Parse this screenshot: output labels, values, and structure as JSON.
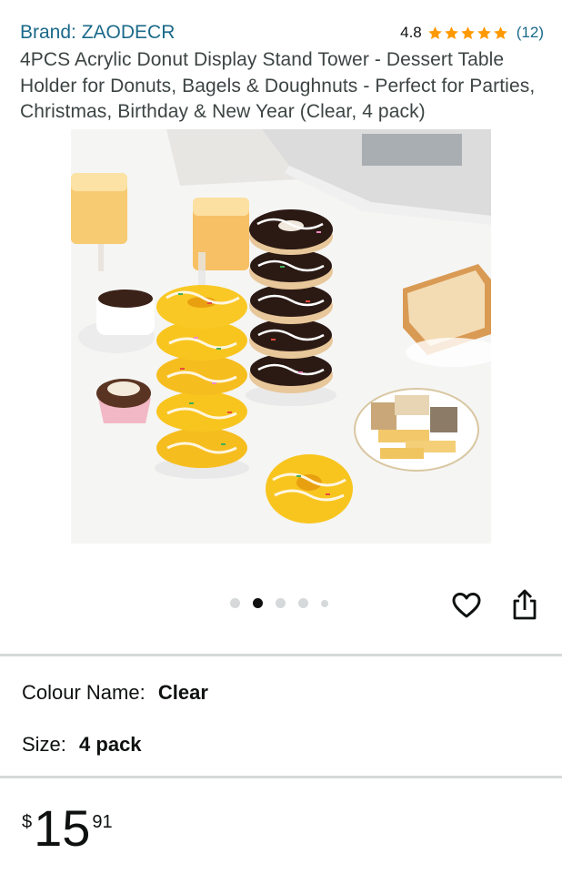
{
  "header": {
    "brand": "Brand: ZAODECR",
    "rating_value": "4.8",
    "rating_count": "(12)",
    "stars": 5,
    "title": "4PCS Acrylic Donut Display Stand Tower - Dessert Table Holder for Donuts, Bagels & Doughnuts - Perfect for Parties, Christmas, Birthday & New Year (Clear, 4 pack)"
  },
  "gallery": {
    "image_count": 5,
    "active_index": 1
  },
  "actions": {
    "wishlist_icon": "heart-icon",
    "share_icon": "share-icon"
  },
  "variations": {
    "colour_label": "Colour Name:",
    "colour_value": "Clear",
    "size_label": "Size:",
    "size_value": "4 pack"
  },
  "price": {
    "symbol": "$",
    "whole": "15",
    "fraction": "91"
  },
  "colors": {
    "link": "#1b6a8a",
    "star": "#ff9900",
    "divider": "#d5d9d9"
  }
}
